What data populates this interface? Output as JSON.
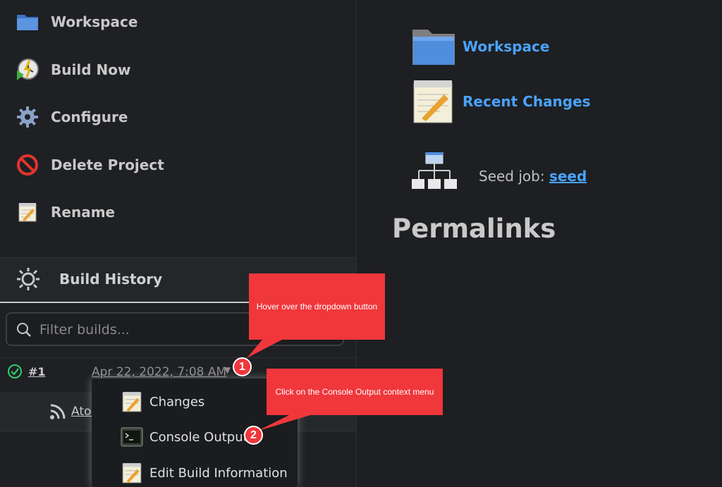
{
  "sidebar": {
    "tasks": [
      {
        "label": "Workspace",
        "icon": "folder-icon"
      },
      {
        "label": "Build Now",
        "icon": "build-now-icon"
      },
      {
        "label": "Configure",
        "icon": "gear-icon"
      },
      {
        "label": "Delete Project",
        "icon": "no-entry-icon"
      },
      {
        "label": "Rename",
        "icon": "notepad-icon"
      }
    ],
    "build_history": {
      "title": "Build History",
      "filter_placeholder": "Filter builds...",
      "builds": [
        {
          "number": "#1",
          "date": "Apr 22, 2022, 7:08 AM",
          "status": "success"
        }
      ],
      "atom_label": "Atom"
    }
  },
  "dropdown": {
    "items": [
      {
        "label": "Changes",
        "icon": "notepad-icon"
      },
      {
        "label": "Console Output",
        "icon": "terminal-icon"
      },
      {
        "label": "Edit Build Information",
        "icon": "notepad-icon"
      }
    ]
  },
  "main": {
    "links": [
      {
        "label": "Workspace",
        "icon": "folder-icon"
      },
      {
        "label": "Recent Changes",
        "icon": "notepad-icon"
      }
    ],
    "seed_job": {
      "prefix": "Seed job: ",
      "link": "seed"
    },
    "permalinks_title": "Permalinks"
  },
  "annotations": [
    {
      "number": "1",
      "text": "Hover over the dropdown button"
    },
    {
      "number": "2",
      "text": "Click on the Console Output context menu"
    }
  ],
  "colors": {
    "accent": "#f0373b",
    "link": "#4aa3ff",
    "success": "#2ecc71"
  }
}
